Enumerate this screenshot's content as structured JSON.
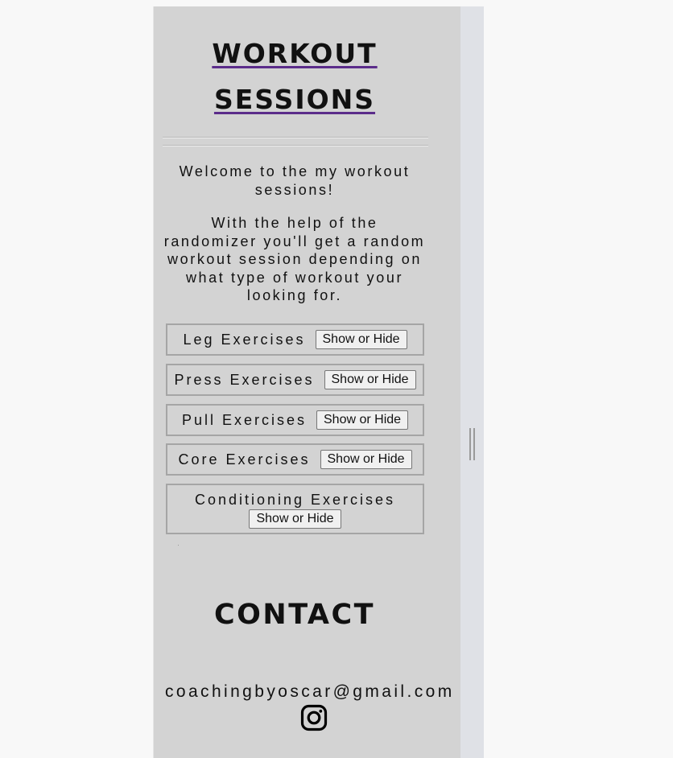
{
  "header": {
    "title_line1": "WORKOUT",
    "title_line2": "SESSIONS"
  },
  "intro": {
    "welcome": "Welcome to the my workout sessions!",
    "description": "With the help of the randomizer you'll get a random workout session depending on what type of workout your looking for."
  },
  "exercises": [
    {
      "label": "Leg Exercises",
      "button": "Show or Hide"
    },
    {
      "label": "Press Exercises",
      "button": "Show or Hide"
    },
    {
      "label": "Pull Exercises",
      "button": "Show or Hide"
    },
    {
      "label": "Core Exercises",
      "button": "Show or Hide"
    },
    {
      "label": "Conditioning Exercises",
      "button": "Show or Hide"
    }
  ],
  "contact": {
    "heading": "CONTACT",
    "email": "coachingbyoscar@gmail.com",
    "icon": "instagram-icon"
  },
  "colors": {
    "page_bg": "#d3d3d3",
    "outer_bg": "#f8f8f8",
    "title_underline": "#5b2c8a"
  }
}
